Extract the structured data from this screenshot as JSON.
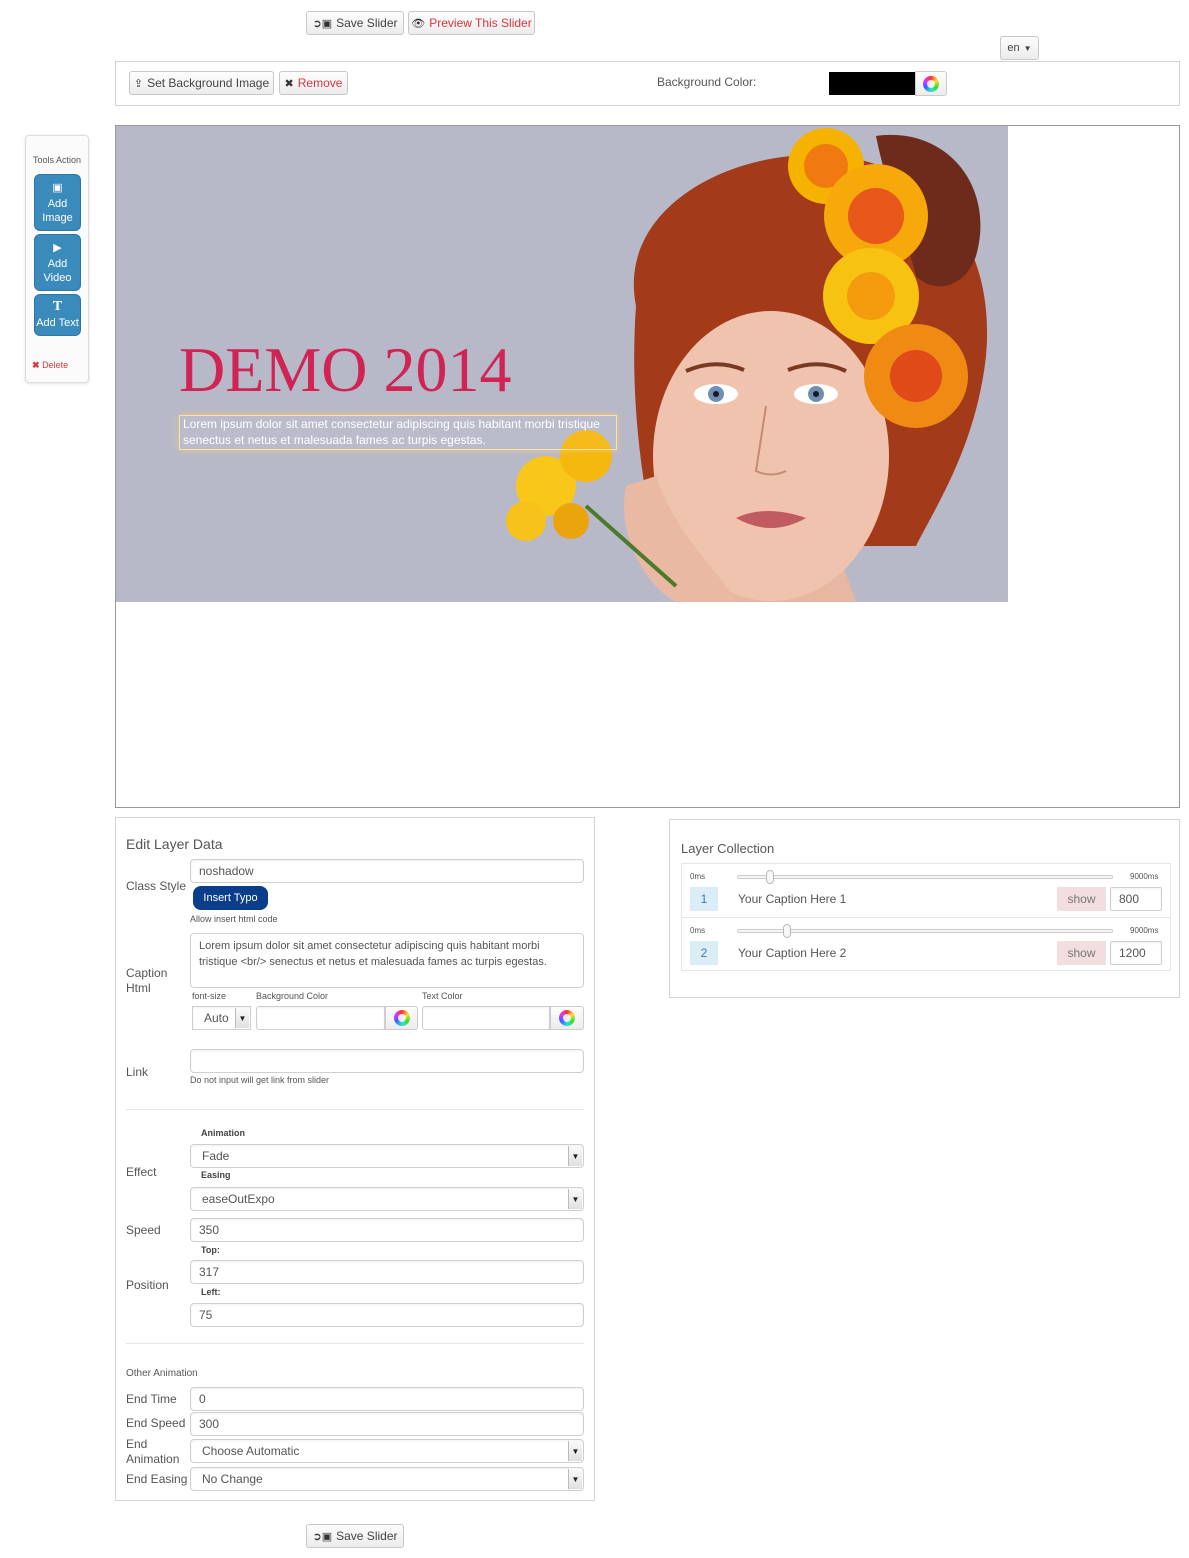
{
  "toolbar": {
    "save_label": "Save Slider",
    "preview_label": "Preview This Slider",
    "lang": "en"
  },
  "background": {
    "set_image_label": "Set Background Image",
    "remove_label": "Remove",
    "color_label": "Background Color:",
    "color_value": "#000000"
  },
  "tools": {
    "title": "Tools Action",
    "add_image": [
      "Add",
      "Image"
    ],
    "add_video": [
      "Add",
      "Video"
    ],
    "add_text": "Add Text",
    "delete": "Delete"
  },
  "slide": {
    "bg_color": "#b7b9c9",
    "headline": "DEMO 2014",
    "headline_color": "#d02454",
    "caption_line1": "Lorem ipsum dolor sit amet consectetur adipiscing quis habitant morbi tristique",
    "caption_line2": "senectus et netus et malesuada fames ac turpis egestas."
  },
  "edit_layer": {
    "title": "Edit Layer Data",
    "class_style_label": "Class Style",
    "class_style_value": "noshadow",
    "insert_typo": "Insert Typo",
    "allow_html_note": "Allow insert html code",
    "caption_html_label": [
      "Caption",
      "Html"
    ],
    "caption_html_value": "Lorem ipsum dolor sit amet consectetur adipiscing quis habitant morbi tristique <br/> senectus et netus et malesuada fames ac turpis egestas.",
    "font_size_label": "font-size",
    "font_size_value": "Auto",
    "bg_color_label": "Background Color",
    "text_color_label": "Text Color",
    "link_label": "Link",
    "link_note": "Do not input will get link from slider",
    "animation_label": "Animation",
    "effect_label": "Effect",
    "effect_value": "Fade",
    "easing_label": "Easing",
    "easing_value": "easeOutExpo",
    "speed_label": "Speed",
    "speed_value": "350",
    "top_label": "Top:",
    "position_label": "Position",
    "top_value": "317",
    "left_label": "Left:",
    "left_value": "75",
    "other_animation": "Other Animation",
    "end_time_label": "End Time",
    "end_time_value": "0",
    "end_speed_label": "End Speed",
    "end_speed_value": "300",
    "end_animation_label": [
      "End",
      "Animation"
    ],
    "end_animation_value": "Choose Automatic",
    "end_easing_label": "End Easing",
    "end_easing_value": "No Change"
  },
  "layer_collection": {
    "title": "Layer Collection",
    "items": [
      {
        "num": "1",
        "caption": "Your Caption Here 1",
        "min": "0ms",
        "max": "9000ms",
        "show": "show",
        "value": "800",
        "position": 0.0889
      },
      {
        "num": "2",
        "caption": "Your Caption Here 2",
        "min": "0ms",
        "max": "9000ms",
        "show": "show",
        "value": "1200",
        "position": 0.1333
      }
    ]
  }
}
